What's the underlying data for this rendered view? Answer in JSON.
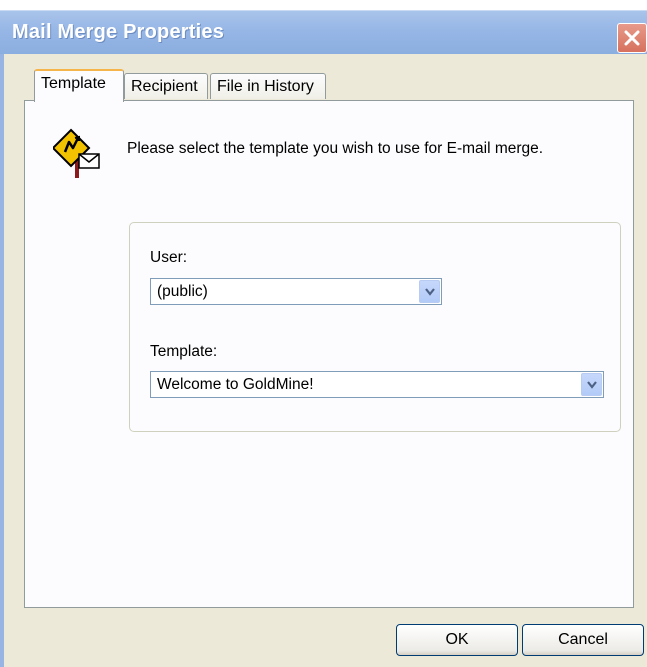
{
  "window": {
    "title": "Mail Merge Properties"
  },
  "tabs": [
    {
      "label": "Template",
      "active": true
    },
    {
      "label": "Recipient",
      "active": false
    },
    {
      "label": "File in History",
      "active": false
    }
  ],
  "template_tab": {
    "instruction": "Please select the template you wish to use for E-mail merge.",
    "icon": "mail-merge-sign-icon",
    "user_label": "User:",
    "user_value": "(public)",
    "template_label": "Template:",
    "template_value": "Welcome to GoldMine!"
  },
  "buttons": {
    "ok": "OK",
    "cancel": "Cancel"
  },
  "colors": {
    "title_bar": "#96b6e6",
    "dialog_bg": "#ece9d8",
    "close_button": "#d6715e",
    "active_tab_accent": "#f5b54a"
  }
}
